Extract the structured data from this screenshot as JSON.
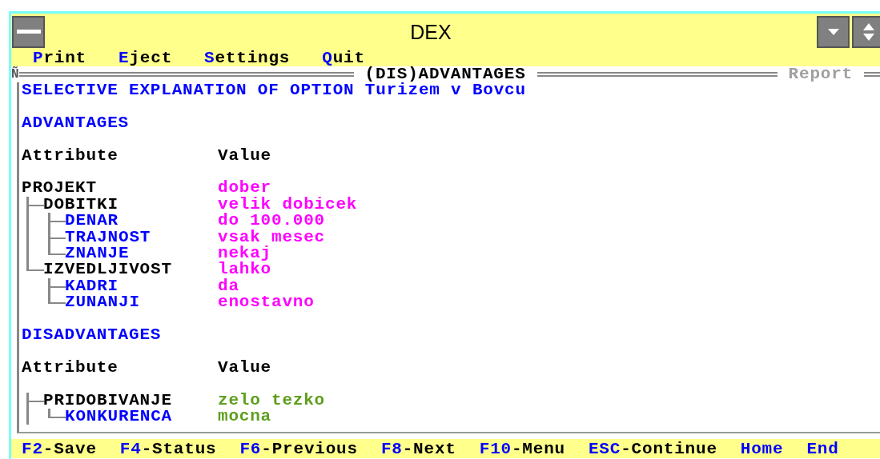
{
  "window": {
    "title": "DEX"
  },
  "menu": [
    {
      "key": "P",
      "label": "rint"
    },
    {
      "key": "E",
      "label": "ject"
    },
    {
      "key": "S",
      "label": "ettings"
    },
    {
      "key": "Q",
      "label": "uit"
    }
  ],
  "header": {
    "marker": "Ñ",
    "title": "(DIS)ADVANTAGES",
    "report": "Report"
  },
  "report": {
    "heading": "SELECTIVE EXPLANATION OF OPTION Turizem v Bovcu",
    "sections": [
      {
        "kind": "advantages",
        "title": "ADVANTAGES",
        "columns": [
          "Attribute",
          "Value"
        ],
        "tree": [
          {
            "name": "PROJEKT",
            "value": "dober",
            "kind": "root",
            "children": [
              {
                "name": "DOBITKI",
                "value": "velik dobicek",
                "kind": "aggregate",
                "children": [
                  {
                    "name": "DENAR",
                    "value": "do 100.000",
                    "kind": "basic"
                  },
                  {
                    "name": "TRAJNOST",
                    "value": "vsak mesec",
                    "kind": "basic"
                  },
                  {
                    "name": "ZNANJE",
                    "value": "nekaj",
                    "kind": "basic"
                  }
                ]
              },
              {
                "name": "IZVEDLJIVOST",
                "value": "lahko",
                "kind": "aggregate",
                "children": [
                  {
                    "name": "KADRI",
                    "value": "da",
                    "kind": "basic"
                  },
                  {
                    "name": "ZUNANJI",
                    "value": "enostavno",
                    "kind": "basic"
                  }
                ]
              }
            ]
          }
        ]
      },
      {
        "kind": "disadvantages",
        "title": "DISADVANTAGES",
        "columns": [
          "Attribute",
          "Value"
        ],
        "tree": [
          {
            "name": "PRIDOBIVANJE",
            "value": "zelo tezko",
            "kind": "aggregate",
            "children": [
              {
                "name": "KONKURENCA",
                "value": "mocna",
                "kind": "basic"
              }
            ]
          }
        ]
      }
    ]
  },
  "footer": [
    {
      "key": "F2",
      "label": "-Save"
    },
    {
      "key": "F4",
      "label": "-Status"
    },
    {
      "key": "F6",
      "label": "-Previous"
    },
    {
      "key": "F8",
      "label": "-Next"
    },
    {
      "key": "F10",
      "label": "-Menu"
    },
    {
      "key": "ESC",
      "label": "-Continue"
    },
    {
      "key": "Home"
    },
    {
      "key": "End"
    }
  ]
}
